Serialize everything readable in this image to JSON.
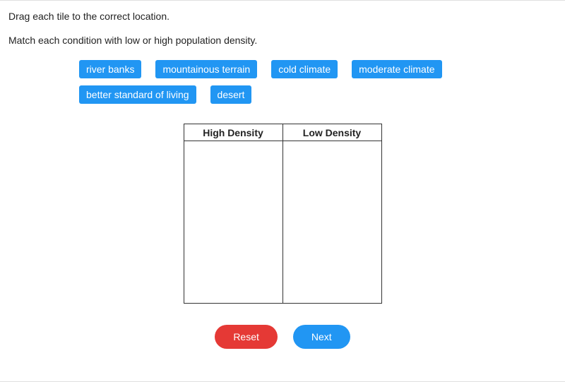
{
  "instruction": "Drag each tile to the correct location.",
  "subinstruction": "Match each condition with low or high population density.",
  "tiles": {
    "row1": [
      "river banks",
      "mountainous terrain",
      "cold climate",
      "moderate climate"
    ],
    "row2": [
      "better standard of living",
      "desert"
    ]
  },
  "table": {
    "headers": [
      "High Density",
      "Low Density"
    ]
  },
  "buttons": {
    "reset": "Reset",
    "next": "Next"
  }
}
